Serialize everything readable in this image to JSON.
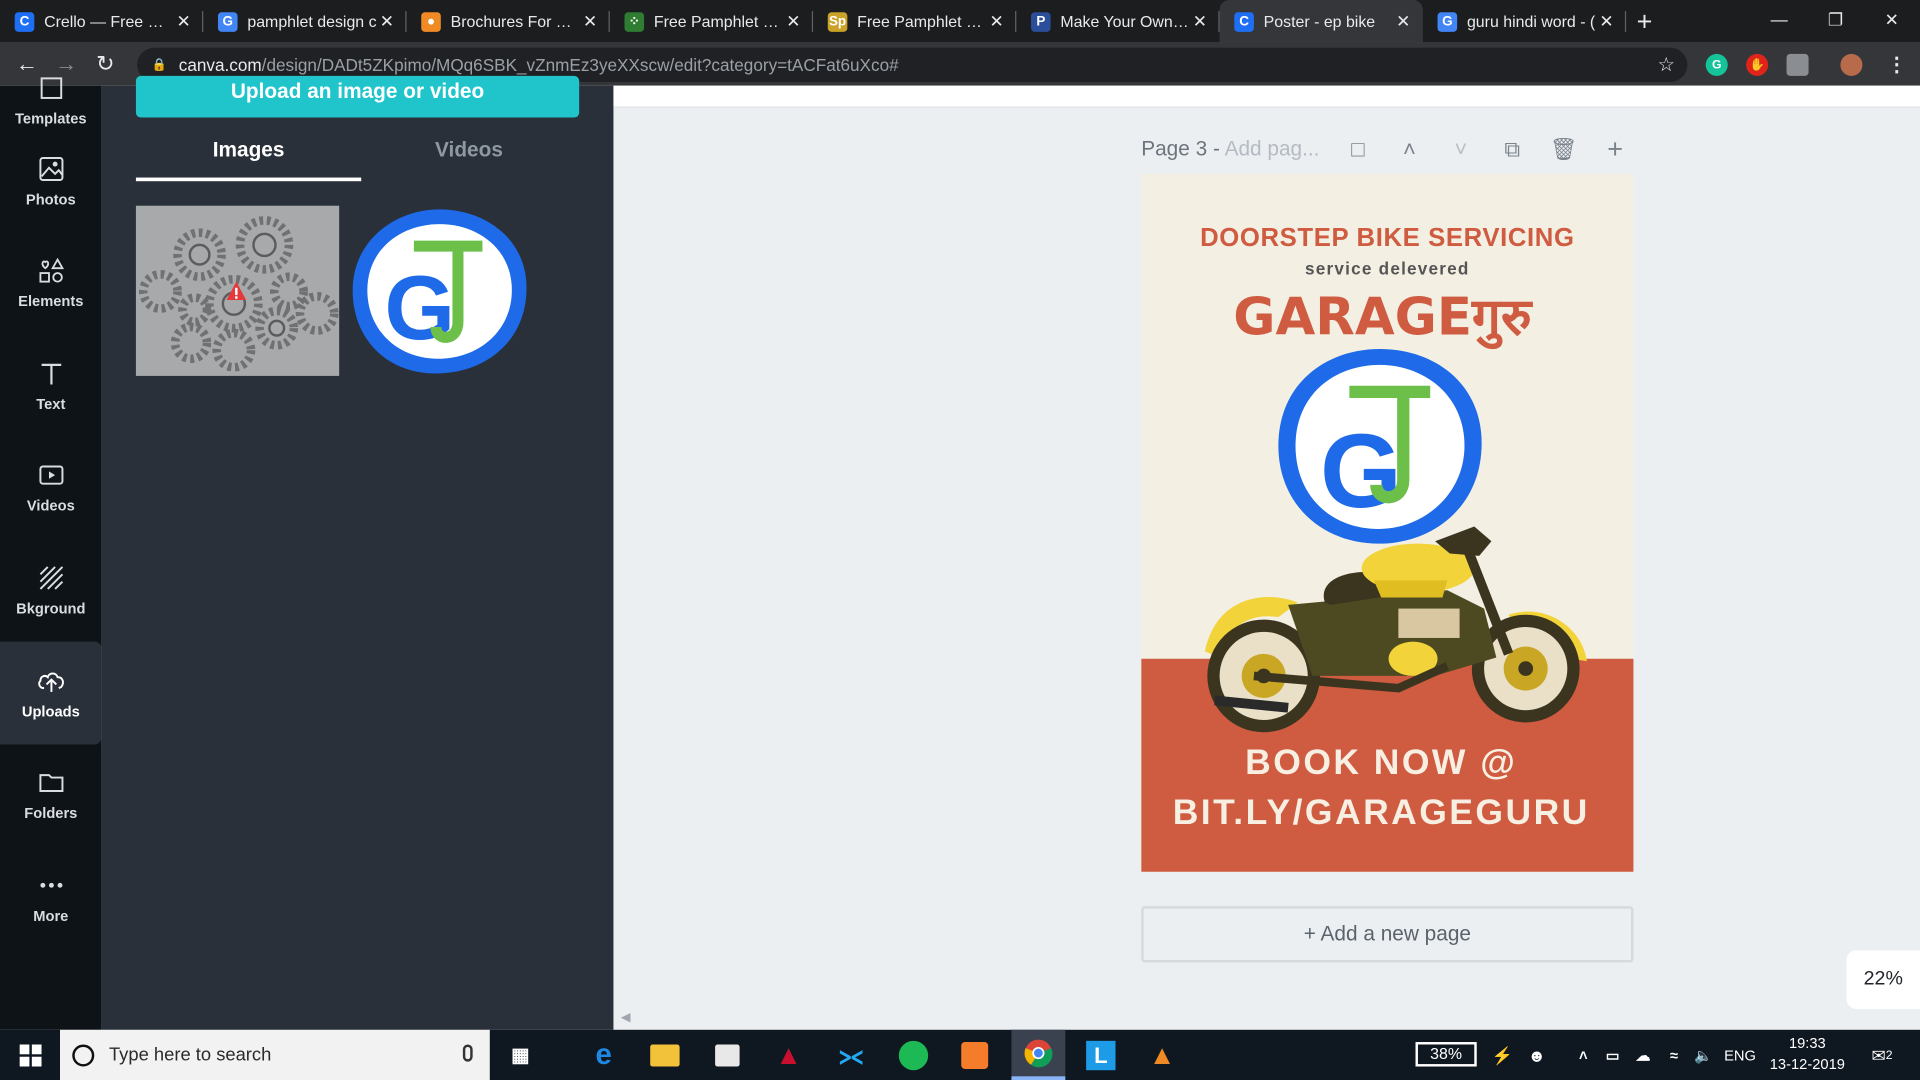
{
  "browser": {
    "tabs": [
      {
        "title": "Crello — Free Grap",
        "fav": "C",
        "color": "#1f6ff5"
      },
      {
        "title": "pamphlet design c",
        "fav": "G",
        "color": "#4285f4"
      },
      {
        "title": "Brochures For Your",
        "fav": "●",
        "color": "#f08a24"
      },
      {
        "title": "Free Pamphlet Mal",
        "fav": "⁘",
        "color": "#2e7d32"
      },
      {
        "title": "Free Pamphlet Mal",
        "fav": "Sp",
        "color": "#c9a227"
      },
      {
        "title": "Make Your Own Br",
        "fav": "P",
        "color": "#2b4e9a"
      },
      {
        "title": "Poster - ep bike",
        "fav": "C",
        "color": "#1f6ff5"
      },
      {
        "title": "guru hindi word - (",
        "fav": "G",
        "color": "#4285f4"
      }
    ],
    "active_tab": 6,
    "url_host": "canva.com",
    "url_path": "/design/DADt5ZKpimo/MQq6SBK_vZnmEz3yeXXscw/edit?category=tACFat6uXco#"
  },
  "sidebar": {
    "items": [
      {
        "label": "Templates",
        "icon": "templates-icon"
      },
      {
        "label": "Photos",
        "icon": "photos-icon"
      },
      {
        "label": "Elements",
        "icon": "elements-icon"
      },
      {
        "label": "Text",
        "icon": "text-icon"
      },
      {
        "label": "Videos",
        "icon": "videos-icon"
      },
      {
        "label": "Bkground",
        "icon": "background-icon"
      },
      {
        "label": "Uploads",
        "icon": "uploads-icon"
      },
      {
        "label": "Folders",
        "icon": "folders-icon"
      },
      {
        "label": "More",
        "icon": "more-icon"
      }
    ],
    "active": "Uploads"
  },
  "panel": {
    "upload_button": "Upload an image or video",
    "tabs": [
      "Images",
      "Videos"
    ],
    "active_tab": "Images"
  },
  "editor": {
    "page_label": "Page 3 -",
    "page_title_placeholder": "Add pag...",
    "add_page": "+ Add a new page",
    "zoom": "22%"
  },
  "poster": {
    "headline": "DOORSTEP BIKE SERVICING",
    "subline": "service delevered",
    "brand": "GARAGEगुरु",
    "cta_line1": "BOOK NOW @",
    "cta_line2": "BIT.LY/GARAGEGURU",
    "colors": {
      "accent": "#cf5b40",
      "background": "#f3efe3",
      "logo_blue": "#1e6ae8",
      "logo_green": "#6cc04a"
    }
  },
  "taskbar": {
    "search_placeholder": "Type here to search",
    "battery": "38%",
    "language": "ENG",
    "time": "19:33",
    "date": "13-12-2019",
    "notifications": "2"
  }
}
